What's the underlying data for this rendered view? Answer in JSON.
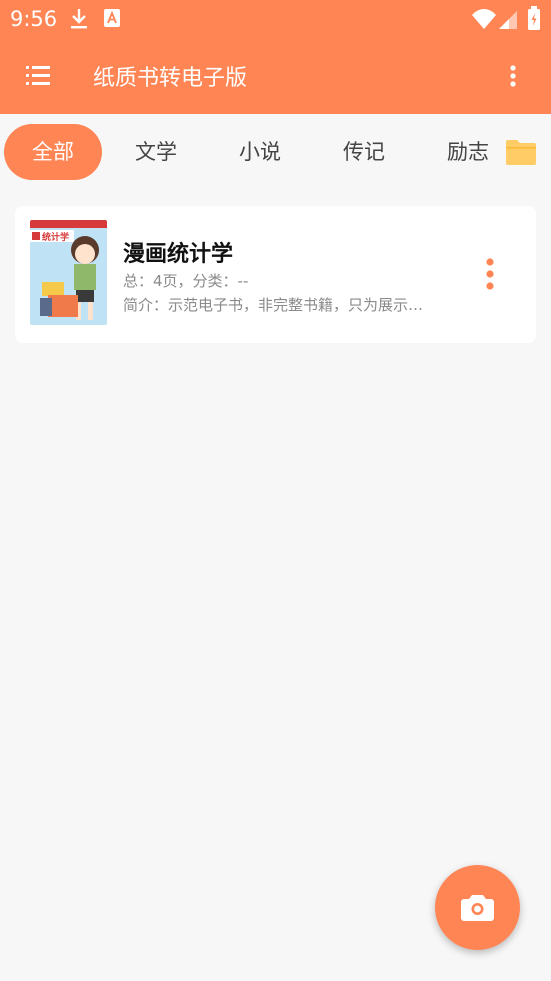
{
  "status_bar": {
    "time": "9:56",
    "icons": [
      "download-icon",
      "a-notification-icon",
      "wifi-icon",
      "signal-icon",
      "battery-icon"
    ]
  },
  "app_bar": {
    "title": "纸质书转电子版",
    "icons": [
      "menu-icon",
      "more-vert-icon"
    ]
  },
  "tabs": [
    {
      "label": "全部",
      "active": true
    },
    {
      "label": "文学",
      "active": false
    },
    {
      "label": "小说",
      "active": false
    },
    {
      "label": "传记",
      "active": false
    },
    {
      "label": "励志",
      "active": false
    }
  ],
  "books": [
    {
      "title": "漫画统计学",
      "meta": "总：4页，分类：--",
      "intro": "简介：示范电子书，非完整书籍，只为展示…",
      "cover_text": "统计学"
    }
  ],
  "colors": {
    "accent": "#ff8555",
    "background": "#f7f7f7",
    "folder": "#ffcc66"
  },
  "fab": {
    "icon": "camera-icon"
  }
}
